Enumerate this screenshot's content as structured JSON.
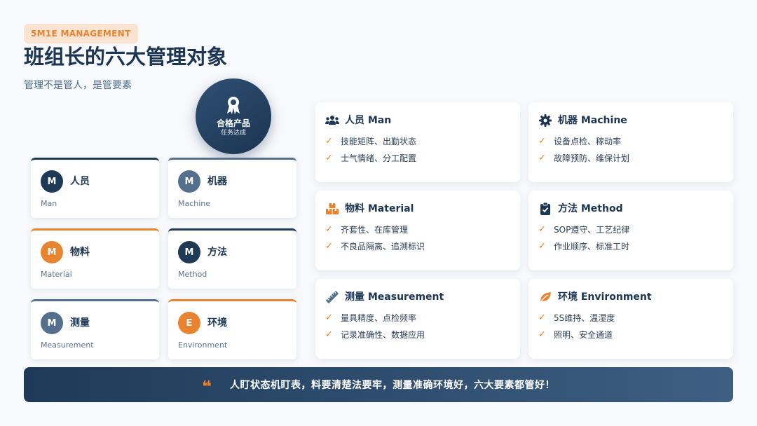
{
  "header": {
    "badge": "5M1E MANAGEMENT",
    "title": "班组长的六大管理对象",
    "subtitle": "管理不是管人，是管要素"
  },
  "hub": {
    "icon": "award-ribbon-icon",
    "label": "合格产品",
    "sub": "任务达成"
  },
  "mini_cards": [
    {
      "letter": "M",
      "zh": "人员",
      "en": "Man",
      "color": "#1f3a57"
    },
    {
      "letter": "M",
      "zh": "机器",
      "en": "Machine",
      "color": "#55708f"
    },
    {
      "letter": "M",
      "zh": "物料",
      "en": "Material",
      "color": "#e8832f"
    },
    {
      "letter": "M",
      "zh": "方法",
      "en": "Method",
      "color": "#1f3a57"
    },
    {
      "letter": "M",
      "zh": "测量",
      "en": "Measurement",
      "color": "#55708f"
    },
    {
      "letter": "E",
      "zh": "环境",
      "en": "Environment",
      "color": "#e8832f"
    }
  ],
  "detail_cards": [
    {
      "title": "人员 Man",
      "icon": "users-icon",
      "items": [
        "技能矩阵、出勤状态",
        "士气情绪、分工配置"
      ]
    },
    {
      "title": "机器 Machine",
      "icon": "gear-icon",
      "items": [
        "设备点检、稼动率",
        "故障预防、维保计划"
      ]
    },
    {
      "title": "物料 Material",
      "icon": "boxes-icon",
      "items": [
        "齐套性、在库管理",
        "不良品隔离、追溯标识"
      ]
    },
    {
      "title": "方法 Method",
      "icon": "clipboard-check-icon",
      "items": [
        "SOP遵守、工艺纪律",
        "作业顺序、标准工时"
      ]
    },
    {
      "title": "测量 Measurement",
      "icon": "ruler-icon",
      "items": [
        "量具精度、点检频率",
        "记录准确性、数据应用"
      ]
    },
    {
      "title": "环境 Environment",
      "icon": "leaf-icon",
      "items": [
        "5S维持、温湿度",
        "照明、安全通道"
      ]
    }
  ],
  "banner": {
    "quote_icon": "quote-icon",
    "text": "人盯状态机盯表，料要清楚法要牢，测量准确环境好，六大要素都管好！"
  },
  "colors": {
    "navy": "#1b3552",
    "slate": "#55708f",
    "accent": "#e8832f"
  }
}
